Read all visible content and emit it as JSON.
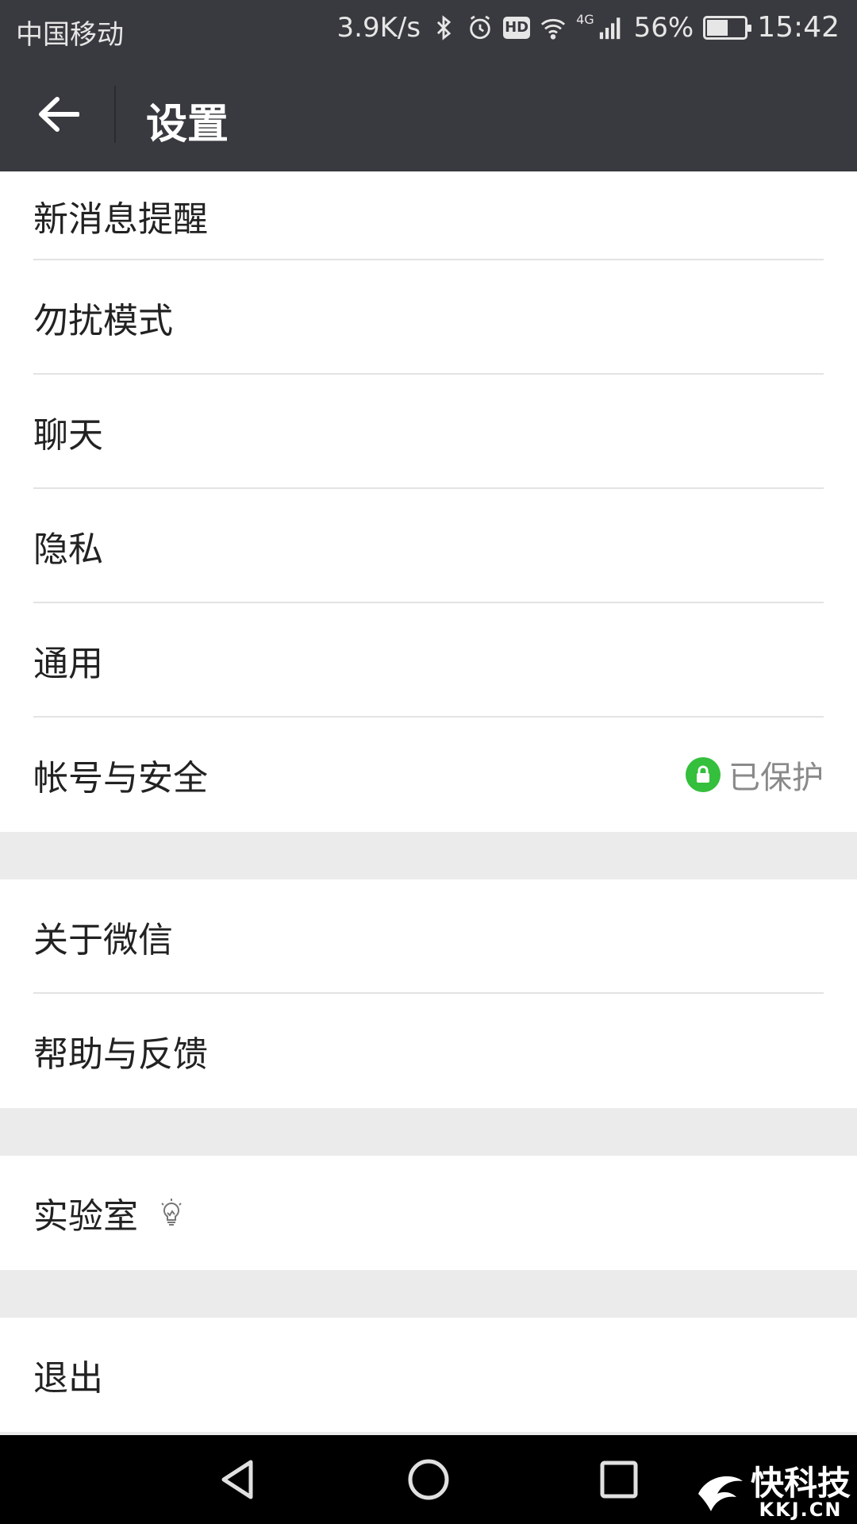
{
  "status_bar": {
    "carrier": "中国移动",
    "net_speed": "3.9K/s",
    "network_type": "4G",
    "battery_percent": "56%",
    "battery_level": 0.56,
    "time": "15:42",
    "hd_label": "HD"
  },
  "app_bar": {
    "title": "设置",
    "back_icon": "arrow-left-icon"
  },
  "groups": [
    [
      {
        "label": "新消息提醒"
      },
      {
        "label": "勿扰模式"
      },
      {
        "label": "聊天"
      },
      {
        "label": "隐私"
      },
      {
        "label": "通用"
      },
      {
        "label": "帐号与安全",
        "status": "已保护",
        "status_icon": "lock-icon",
        "status_color": "#34bf3c"
      }
    ],
    [
      {
        "label": "关于微信"
      },
      {
        "label": "帮助与反馈"
      }
    ],
    [
      {
        "label": "实验室",
        "icon": "lightbulb-icon"
      }
    ],
    [
      {
        "label": "退出"
      }
    ]
  ],
  "nav_bar": {
    "back": "triangle-back-icon",
    "home": "circle-home-icon",
    "recents": "square-recents-icon"
  },
  "watermark": {
    "text_cn": "快科技",
    "text_en": "KKJ.CN"
  },
  "colors": {
    "header_bg": "#393a3f",
    "page_bg": "#ebebeb",
    "accent_green": "#34bf3c"
  }
}
